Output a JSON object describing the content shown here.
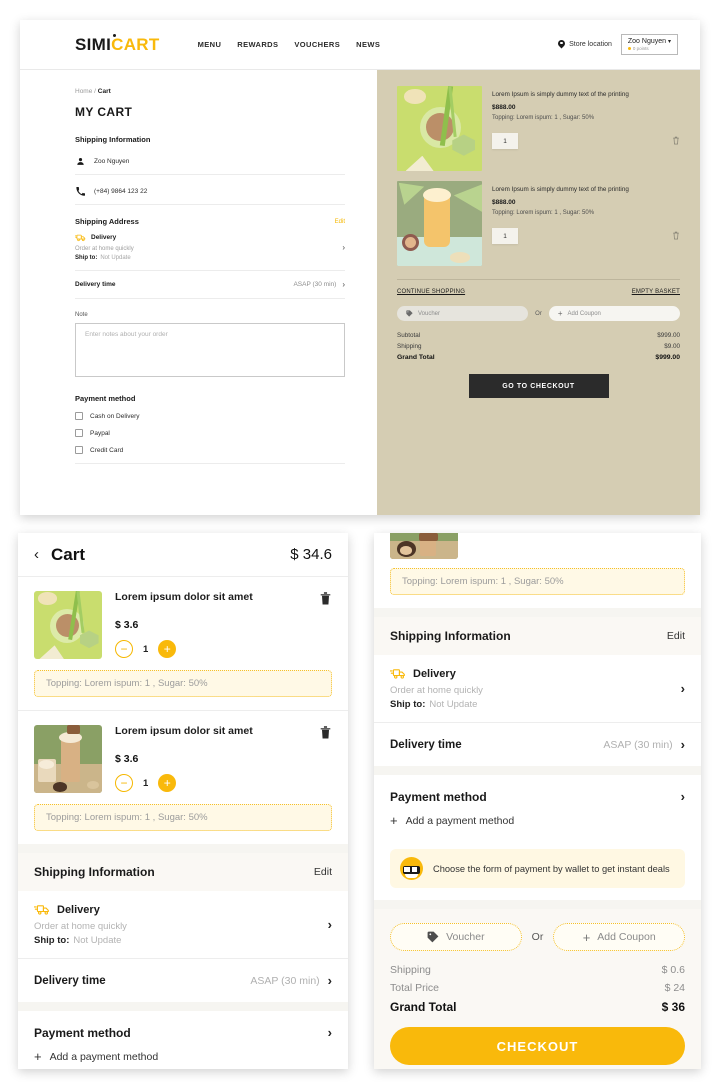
{
  "desktop": {
    "header": {
      "logo_black": "SIMI",
      "logo_yellow": "CART",
      "nav": [
        "MENU",
        "REWARDS",
        "VOUCHERS",
        "NEWS"
      ],
      "store_location": "Store location",
      "user_name": "Zoo Nguyen",
      "user_caret": "▾",
      "user_points": "0 points"
    },
    "left": {
      "breadcrumb_home": "Home",
      "breadcrumb_sep": " / ",
      "breadcrumb_current": "Cart",
      "title": "MY CART",
      "shipping_info_heading": "Shipping Information",
      "customer_name": "Zoo Nguyen",
      "customer_phone": "(+84) 9864 123 22",
      "shipping_address_heading": "Shipping Address",
      "edit_label": "Edit",
      "delivery_label": "Delivery",
      "delivery_sub": "Order at home quickly",
      "ship_to_label": "Ship to:",
      "ship_to_value": "Not Update",
      "delivery_time_label": "Delivery time",
      "delivery_time_value": "ASAP (30 min)",
      "note_label": "Note",
      "note_placeholder": "Enter notes about your order",
      "payment_heading": "Payment method",
      "payment_options": [
        "Cash on Delivery",
        "Paypal",
        "Credit Card"
      ]
    },
    "right": {
      "items": [
        {
          "name": "Lorem Ipsum is simply dummy text of the printing",
          "price": "$888.00",
          "topping": "Topping: Lorem ispum: 1 , Sugar: 50%",
          "qty": "1"
        },
        {
          "name": "Lorem Ipsum is simply dummy text of the printing",
          "price": "$888.00",
          "topping": "Topping: Lorem ispum: 1 , Sugar: 50%",
          "qty": "1"
        }
      ],
      "continue_shopping": "CONTINUE SHOPPING",
      "empty_basket": "EMPTY BASKET",
      "voucher_placeholder": "Voucher",
      "or_label": "Or",
      "add_coupon": "Add Coupon",
      "subtotal_label": "Subtotal",
      "subtotal_value": "$999.00",
      "shipping_label": "Shipping",
      "shipping_value": "$9.00",
      "grand_label": "Grand Total",
      "grand_value": "$999.00",
      "checkout_label": "GO TO CHECKOUT"
    }
  },
  "mobile_left": {
    "back_icon": "‹",
    "title": "Cart",
    "total": "$ 34.6",
    "items": [
      {
        "name": "Lorem ipsum dolor sit amet",
        "price": "$ 3.6",
        "qty": "1",
        "topping": "Topping: Lorem ispum: 1 , Sugar: 50%"
      },
      {
        "name": "Lorem ipsum dolor sit amet",
        "price": "$ 3.6",
        "qty": "1",
        "topping": "Topping: Lorem ispum: 1 , Sugar: 50%"
      }
    ],
    "shipping_info_heading": "Shipping Information",
    "edit_label": "Edit",
    "delivery_label": "Delivery",
    "delivery_sub": "Order at home quickly",
    "ship_to_label": "Ship to:",
    "ship_to_value": "Not Update",
    "delivery_time_label": "Delivery time",
    "delivery_time_value": "ASAP (30 min)",
    "payment_heading": "Payment method",
    "add_payment": "Add a payment method",
    "minus": "−",
    "plus": "+"
  },
  "mobile_right": {
    "topping": "Topping: Lorem ispum: 1 , Sugar: 50%",
    "shipping_info_heading": "Shipping Information",
    "edit_label": "Edit",
    "delivery_label": "Delivery",
    "delivery_sub": "Order at home quickly",
    "ship_to_label": "Ship to:",
    "ship_to_value": "Not Update",
    "delivery_time_label": "Delivery time",
    "delivery_time_value": "ASAP (30 min)",
    "payment_heading": "Payment method",
    "add_payment": "Add a payment method",
    "wallet_promo": "Choose the form of payment by wallet to get instant deals",
    "voucher_placeholder": "Voucher",
    "or_label": "Or",
    "add_coupon": "Add Coupon",
    "shipping_label": "Shipping",
    "shipping_value": "$ 0.6",
    "total_price_label": "Total Price",
    "total_price_value": "$ 24",
    "grand_label": "Grand Total",
    "grand_value": "$ 36",
    "checkout_label": "CHECKOUT"
  },
  "colors": {
    "accent_yellow": "#f9b90b",
    "panel_beige": "#d5cdb3",
    "dark_button": "#2b2b2b",
    "soft_bg": "#faf8f4"
  }
}
